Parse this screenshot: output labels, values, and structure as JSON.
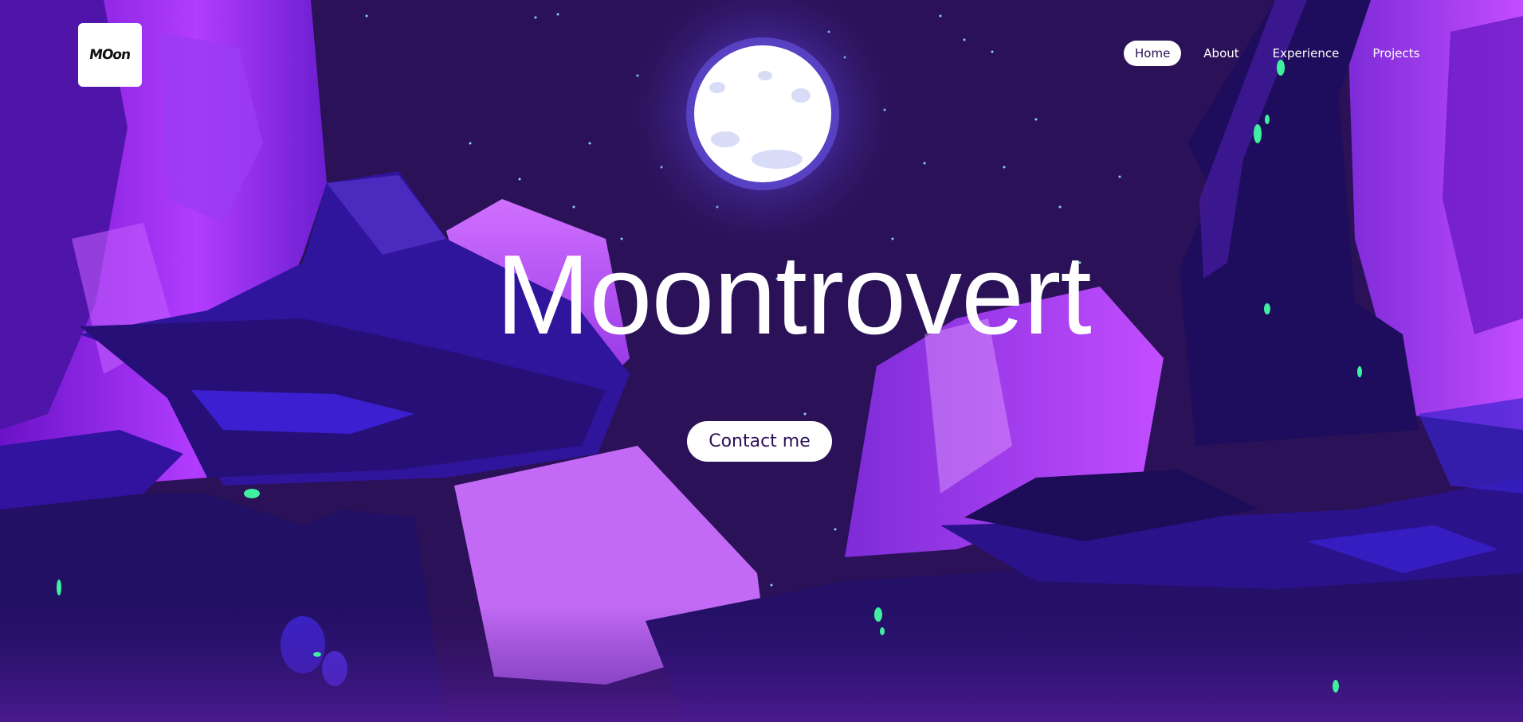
{
  "logo": {
    "text": "MOon",
    "icon": "moon-logo-icon"
  },
  "nav": {
    "items": [
      {
        "label": "Home",
        "active": true
      },
      {
        "label": "About",
        "active": false
      },
      {
        "label": "Experience",
        "active": false
      },
      {
        "label": "Projects",
        "active": false
      }
    ]
  },
  "hero": {
    "title": "Moontrovert",
    "cta_label": "Contact me"
  },
  "colors": {
    "sky": "#2b1157",
    "rock_dark": "#24106a",
    "rock_purple": "#7a22d8",
    "glow_violet": "#c04cff",
    "gem_green": "#3ef0a0",
    "moon": "#ffffff",
    "button_text": "#2b1157"
  }
}
